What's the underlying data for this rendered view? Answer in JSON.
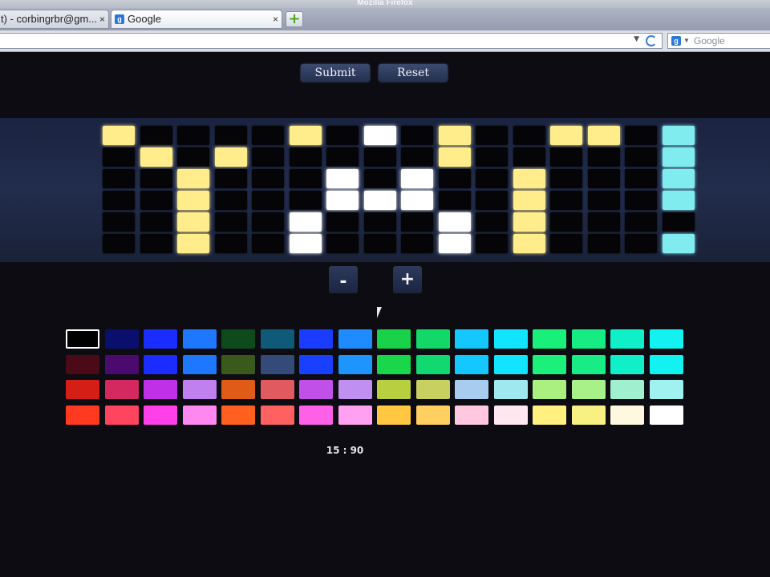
{
  "window": {
    "title": "Mozilla Firefox"
  },
  "tabs": [
    {
      "label": "t) - corbingrbr@gm...",
      "close": "×"
    },
    {
      "label": "Google",
      "close": "×",
      "favicon": "g-icon"
    }
  ],
  "new_tab": {
    "symbol": "+"
  },
  "search": {
    "placeholder": "Google",
    "engine_icon": "google-icon"
  },
  "controls": {
    "submit_label": "Submit",
    "reset_label": "Reset",
    "minus_label": "-",
    "plus_label": "+"
  },
  "readout": "15 : 90",
  "grid": {
    "columns": 15,
    "rows": 6,
    "cells": [
      [
        "#ffec8a",
        "#050507",
        "#050507",
        "#050507",
        "#050507",
        "#050507",
        "#050507",
        "#050507",
        "#050507",
        "#050507",
        "#050507",
        "#050507",
        "#050507",
        "#050507",
        "#050507",
        "#80ecf0"
      ],
      [
        "#050507",
        "#ffec8a",
        "#050507",
        "#ffec8a",
        "#050507",
        "#050507",
        "#050507",
        "#050507",
        "#050507",
        "#ffec8a",
        "#050507",
        "#050507",
        "#050507",
        "#050507",
        "#050507",
        "#80ecf0"
      ],
      [
        "#050507",
        "#050507",
        "#ffec8a",
        "#050507",
        "#050507",
        "#050507",
        "#ffffff",
        "#050507",
        "#ffffff",
        "#050507",
        "#050507",
        "#ffec8a",
        "#050507",
        "#050507",
        "#050507",
        "#80ecf0"
      ],
      [
        "#050507",
        "#050507",
        "#ffec8a",
        "#050507",
        "#050507",
        "#050507",
        "#ffffff",
        "#ffffff",
        "#ffffff",
        "#050507",
        "#050507",
        "#ffec8a",
        "#050507",
        "#050507",
        "#050507",
        "#80ecf0"
      ],
      [
        "#050507",
        "#050507",
        "#ffec8a",
        "#050507",
        "#050507",
        "#ffffff",
        "#050507",
        "#050507",
        "#050507",
        "#ffffff",
        "#050507",
        "#ffec8a",
        "#050507",
        "#050507",
        "#050507",
        "#050507"
      ],
      [
        "#050507",
        "#050507",
        "#ffec8a",
        "#050507",
        "#050507",
        "#ffffff",
        "#050507",
        "#050507",
        "#050507",
        "#ffffff",
        "#050507",
        "#ffec8a",
        "#050507",
        "#050507",
        "#050507",
        "#80ecf0"
      ]
    ],
    "top_row_overrides": {
      "col5": "#ffec8a",
      "col7": "#ffffff",
      "col9": "#ffec8a",
      "col12": "#ffec8a",
      "col13": "#ffec8a"
    }
  },
  "palette": {
    "selected_index": 0,
    "rows": [
      [
        "#000000",
        "#0a0f6e",
        "#1a2cff",
        "#1e78ff",
        "#0e4a1c",
        "#0e5a78",
        "#1a3cff",
        "#1e8cff",
        "#19d24a",
        "#12d868",
        "#14c8ff",
        "#10e4ff",
        "#18f07a",
        "#16ec82",
        "#10f0c8",
        "#12f2f0"
      ],
      [
        "#4a0a18",
        "#4a0a6e",
        "#1a2cff",
        "#1e78ff",
        "#3a5a1c",
        "#344a78",
        "#1a40ff",
        "#1e94ff",
        "#1ad64a",
        "#12d870",
        "#14c8ff",
        "#12e4ff",
        "#1af07a",
        "#18ec84",
        "#10f0c8",
        "#12f2f0"
      ],
      [
        "#d41e16",
        "#d42860",
        "#c030e8",
        "#c080f0",
        "#e05a18",
        "#e05a60",
        "#c050e8",
        "#c090f0",
        "#b8d040",
        "#c8d060",
        "#a8ccf0",
        "#a0e8f0",
        "#aaf080",
        "#a8f088",
        "#a0f0d0",
        "#a0f2f0"
      ],
      [
        "#ff3a20",
        "#ff4460",
        "#ff40e8",
        "#ff88f0",
        "#ff6020",
        "#ff6060",
        "#ff60e8",
        "#ffa0f0",
        "#ffc840",
        "#ffd060",
        "#ffc8e0",
        "#ffe8f0",
        "#fff080",
        "#f8f080",
        "#fff8e0",
        "#ffffff"
      ]
    ]
  },
  "icons": {
    "refresh": "refresh-icon",
    "dropdown": "dropdown-icon",
    "cursor": "mouse-cursor-icon"
  }
}
